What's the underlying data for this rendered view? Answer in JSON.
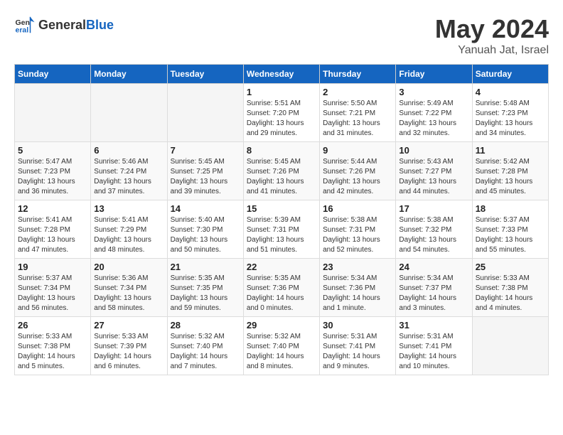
{
  "header": {
    "logo_general": "General",
    "logo_blue": "Blue",
    "month_year": "May 2024",
    "location": "Yanuah Jat, Israel"
  },
  "days_of_week": [
    "Sunday",
    "Monday",
    "Tuesday",
    "Wednesday",
    "Thursday",
    "Friday",
    "Saturday"
  ],
  "weeks": [
    [
      {
        "day": "",
        "info": ""
      },
      {
        "day": "",
        "info": ""
      },
      {
        "day": "",
        "info": ""
      },
      {
        "day": "1",
        "info": "Sunrise: 5:51 AM\nSunset: 7:20 PM\nDaylight: 13 hours and 29 minutes."
      },
      {
        "day": "2",
        "info": "Sunrise: 5:50 AM\nSunset: 7:21 PM\nDaylight: 13 hours and 31 minutes."
      },
      {
        "day": "3",
        "info": "Sunrise: 5:49 AM\nSunset: 7:22 PM\nDaylight: 13 hours and 32 minutes."
      },
      {
        "day": "4",
        "info": "Sunrise: 5:48 AM\nSunset: 7:23 PM\nDaylight: 13 hours and 34 minutes."
      }
    ],
    [
      {
        "day": "5",
        "info": "Sunrise: 5:47 AM\nSunset: 7:23 PM\nDaylight: 13 hours and 36 minutes."
      },
      {
        "day": "6",
        "info": "Sunrise: 5:46 AM\nSunset: 7:24 PM\nDaylight: 13 hours and 37 minutes."
      },
      {
        "day": "7",
        "info": "Sunrise: 5:45 AM\nSunset: 7:25 PM\nDaylight: 13 hours and 39 minutes."
      },
      {
        "day": "8",
        "info": "Sunrise: 5:45 AM\nSunset: 7:26 PM\nDaylight: 13 hours and 41 minutes."
      },
      {
        "day": "9",
        "info": "Sunrise: 5:44 AM\nSunset: 7:26 PM\nDaylight: 13 hours and 42 minutes."
      },
      {
        "day": "10",
        "info": "Sunrise: 5:43 AM\nSunset: 7:27 PM\nDaylight: 13 hours and 44 minutes."
      },
      {
        "day": "11",
        "info": "Sunrise: 5:42 AM\nSunset: 7:28 PM\nDaylight: 13 hours and 45 minutes."
      }
    ],
    [
      {
        "day": "12",
        "info": "Sunrise: 5:41 AM\nSunset: 7:28 PM\nDaylight: 13 hours and 47 minutes."
      },
      {
        "day": "13",
        "info": "Sunrise: 5:41 AM\nSunset: 7:29 PM\nDaylight: 13 hours and 48 minutes."
      },
      {
        "day": "14",
        "info": "Sunrise: 5:40 AM\nSunset: 7:30 PM\nDaylight: 13 hours and 50 minutes."
      },
      {
        "day": "15",
        "info": "Sunrise: 5:39 AM\nSunset: 7:31 PM\nDaylight: 13 hours and 51 minutes."
      },
      {
        "day": "16",
        "info": "Sunrise: 5:38 AM\nSunset: 7:31 PM\nDaylight: 13 hours and 52 minutes."
      },
      {
        "day": "17",
        "info": "Sunrise: 5:38 AM\nSunset: 7:32 PM\nDaylight: 13 hours and 54 minutes."
      },
      {
        "day": "18",
        "info": "Sunrise: 5:37 AM\nSunset: 7:33 PM\nDaylight: 13 hours and 55 minutes."
      }
    ],
    [
      {
        "day": "19",
        "info": "Sunrise: 5:37 AM\nSunset: 7:34 PM\nDaylight: 13 hours and 56 minutes."
      },
      {
        "day": "20",
        "info": "Sunrise: 5:36 AM\nSunset: 7:34 PM\nDaylight: 13 hours and 58 minutes."
      },
      {
        "day": "21",
        "info": "Sunrise: 5:35 AM\nSunset: 7:35 PM\nDaylight: 13 hours and 59 minutes."
      },
      {
        "day": "22",
        "info": "Sunrise: 5:35 AM\nSunset: 7:36 PM\nDaylight: 14 hours and 0 minutes."
      },
      {
        "day": "23",
        "info": "Sunrise: 5:34 AM\nSunset: 7:36 PM\nDaylight: 14 hours and 1 minute."
      },
      {
        "day": "24",
        "info": "Sunrise: 5:34 AM\nSunset: 7:37 PM\nDaylight: 14 hours and 3 minutes."
      },
      {
        "day": "25",
        "info": "Sunrise: 5:33 AM\nSunset: 7:38 PM\nDaylight: 14 hours and 4 minutes."
      }
    ],
    [
      {
        "day": "26",
        "info": "Sunrise: 5:33 AM\nSunset: 7:38 PM\nDaylight: 14 hours and 5 minutes."
      },
      {
        "day": "27",
        "info": "Sunrise: 5:33 AM\nSunset: 7:39 PM\nDaylight: 14 hours and 6 minutes."
      },
      {
        "day": "28",
        "info": "Sunrise: 5:32 AM\nSunset: 7:40 PM\nDaylight: 14 hours and 7 minutes."
      },
      {
        "day": "29",
        "info": "Sunrise: 5:32 AM\nSunset: 7:40 PM\nDaylight: 14 hours and 8 minutes."
      },
      {
        "day": "30",
        "info": "Sunrise: 5:31 AM\nSunset: 7:41 PM\nDaylight: 14 hours and 9 minutes."
      },
      {
        "day": "31",
        "info": "Sunrise: 5:31 AM\nSunset: 7:41 PM\nDaylight: 14 hours and 10 minutes."
      },
      {
        "day": "",
        "info": ""
      }
    ]
  ]
}
